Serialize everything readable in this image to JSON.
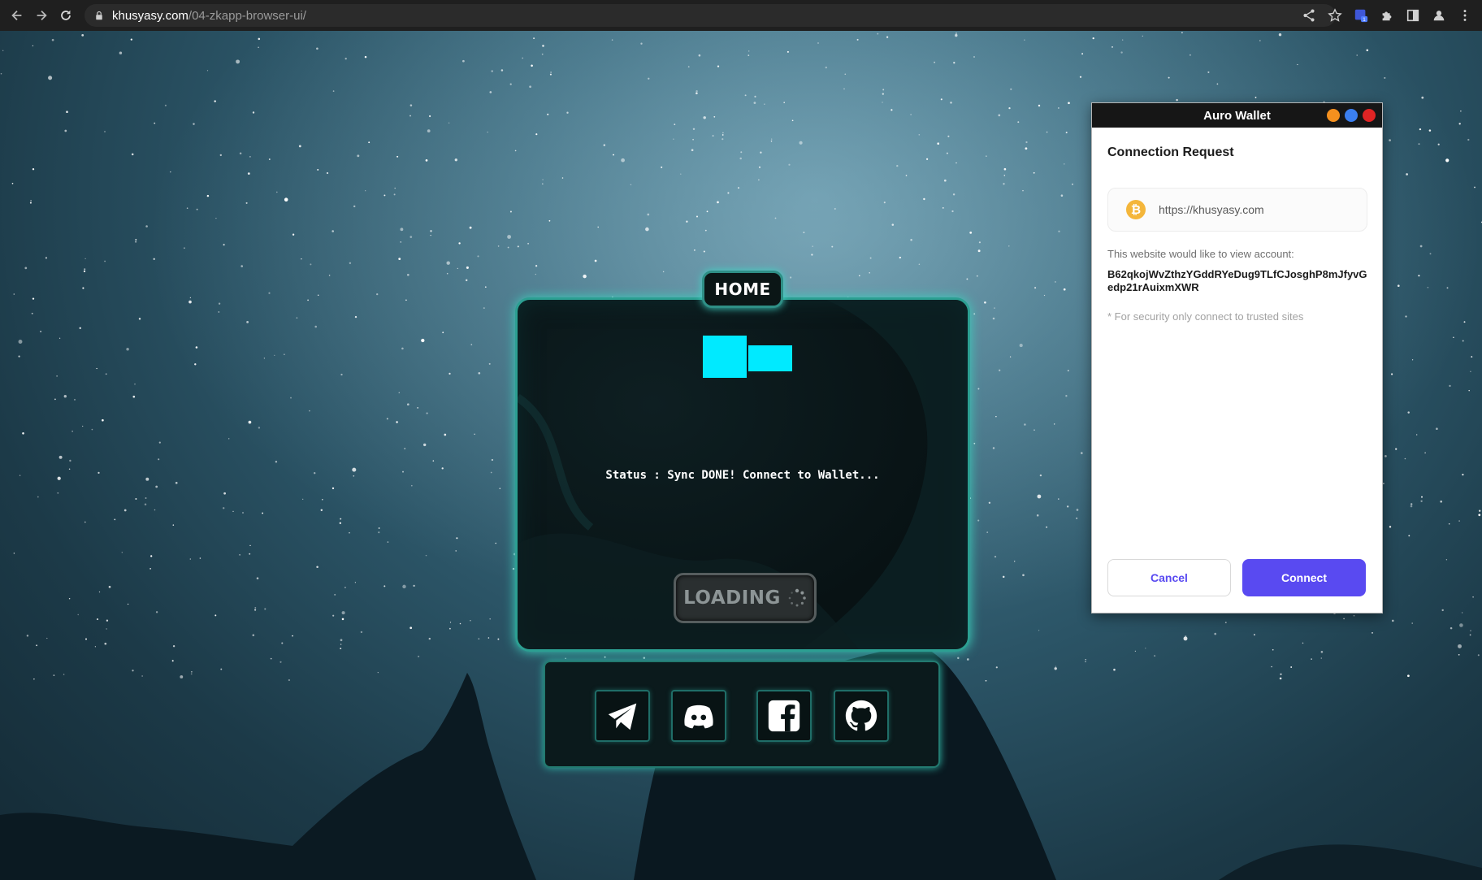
{
  "browser": {
    "url_host": "khusyasy.com",
    "url_path": "/04-zkapp-browser-ui/"
  },
  "app": {
    "home_tab_label": "HOME",
    "status_text": "Status : Sync DONE! Connect to Wallet...",
    "loading_label": "LOADING",
    "accent_color": "#00eaff",
    "social_links": [
      {
        "icon": "telegram-icon"
      },
      {
        "icon": "discord-icon"
      },
      {
        "icon": "facebook-icon"
      },
      {
        "icon": "github-icon"
      }
    ]
  },
  "wallet": {
    "title": "Auro Wallet",
    "heading": "Connection Request",
    "site_url": "https://khusyasy.com",
    "site_icon_glyph": "₿",
    "description": "This website would like to view account:",
    "account": "B62qkojWvZthzYGddRYeDug9TLfCJosghP8mJfyvGedp21rAuixmXWR",
    "security_note": "* For security only connect to trusted sites",
    "cancel_label": "Cancel",
    "connect_label": "Connect",
    "primary_color": "#594af1",
    "window_dot_colors": [
      "#f5901e",
      "#3b7ff0",
      "#e02424"
    ]
  }
}
